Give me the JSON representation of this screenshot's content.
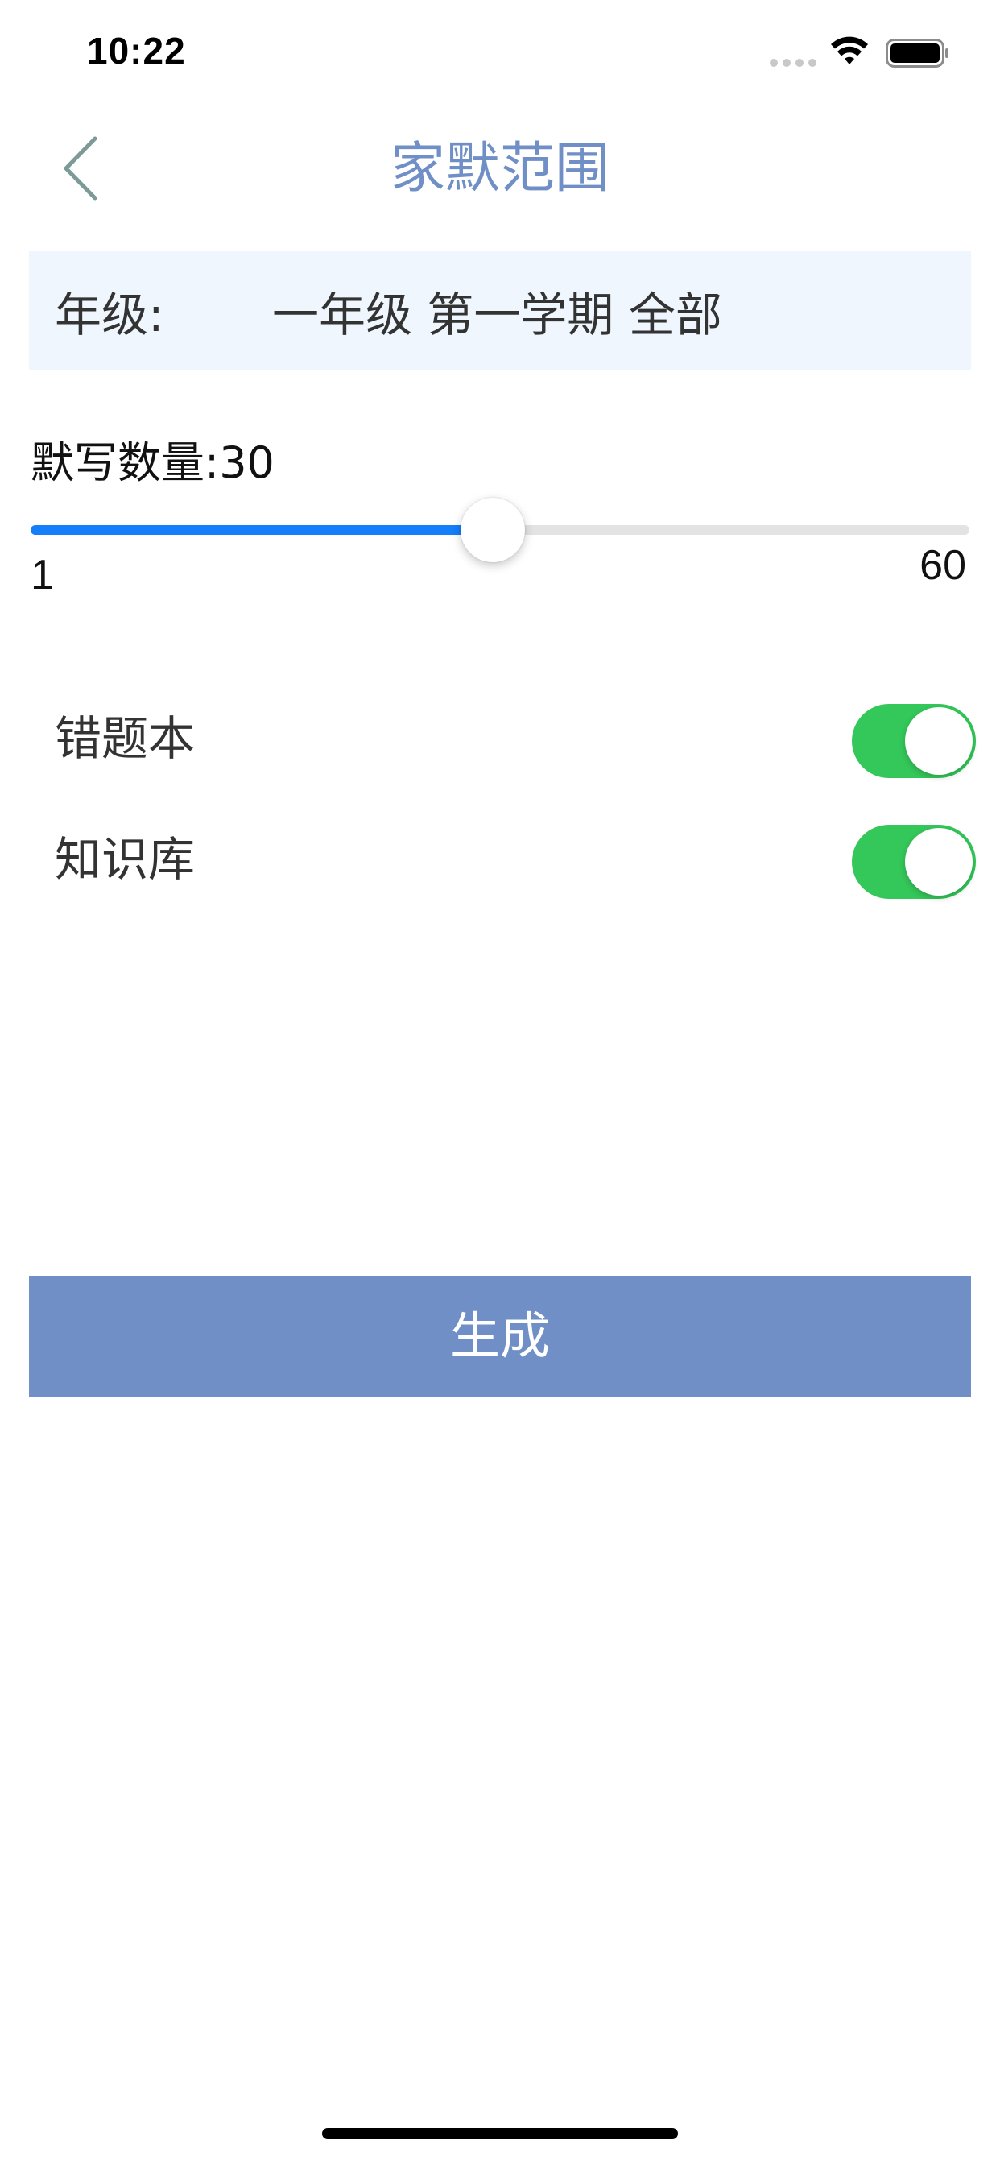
{
  "status_bar": {
    "time": "10:22",
    "icons": [
      "signal-dots-icon",
      "wifi-icon",
      "battery-icon"
    ]
  },
  "nav": {
    "title": "家默范围",
    "back_icon": "chevron-left-icon"
  },
  "grade": {
    "label": "年级:",
    "value": "一年级 第一学期 全部"
  },
  "dictation_count": {
    "label": "默写数量:30",
    "value": 30,
    "min": 1,
    "max": 60,
    "min_label": "1",
    "max_label": "60"
  },
  "options": [
    {
      "label": "错题本",
      "enabled": true
    },
    {
      "label": "知识库",
      "enabled": true
    }
  ],
  "generate_button": {
    "label": "生成"
  },
  "colors": {
    "accent": "#6f8fc6",
    "slider_fill": "#147efb",
    "slider_track": "#e3e3e3",
    "toggle_on": "#34c759",
    "grade_row_bg": "#eff6fd"
  }
}
